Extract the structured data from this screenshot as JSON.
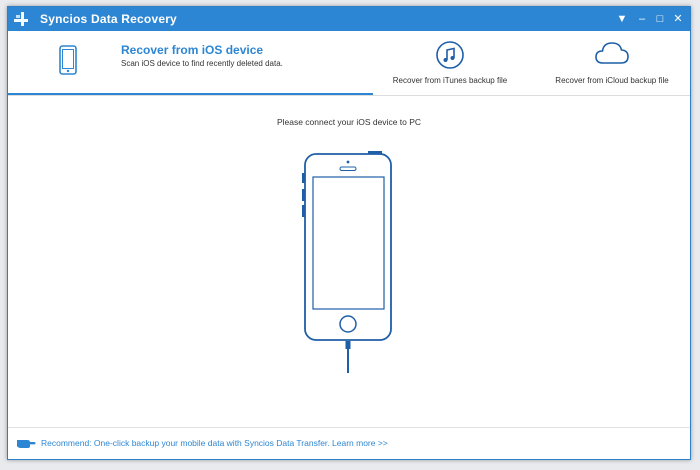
{
  "window": {
    "title": "Syncios Data Recovery",
    "controls": [
      "▼",
      "–",
      "□",
      "✕"
    ]
  },
  "nav": {
    "active": {
      "title": "Recover from iOS device",
      "subtitle": "Scan iOS device to find recently deleted data."
    },
    "itunes_label": "Recover from iTunes backup file",
    "icloud_label": "Recover from iCloud backup file"
  },
  "main": {
    "prompt": "Please connect your iOS device to PC"
  },
  "footer": {
    "recommend": "Recommend: One-click backup your mobile data with Syncios Data Transfer. Learn more >>"
  },
  "colors": {
    "accent": "#2d86d3",
    "phone_outline": "#1f5fa8"
  }
}
